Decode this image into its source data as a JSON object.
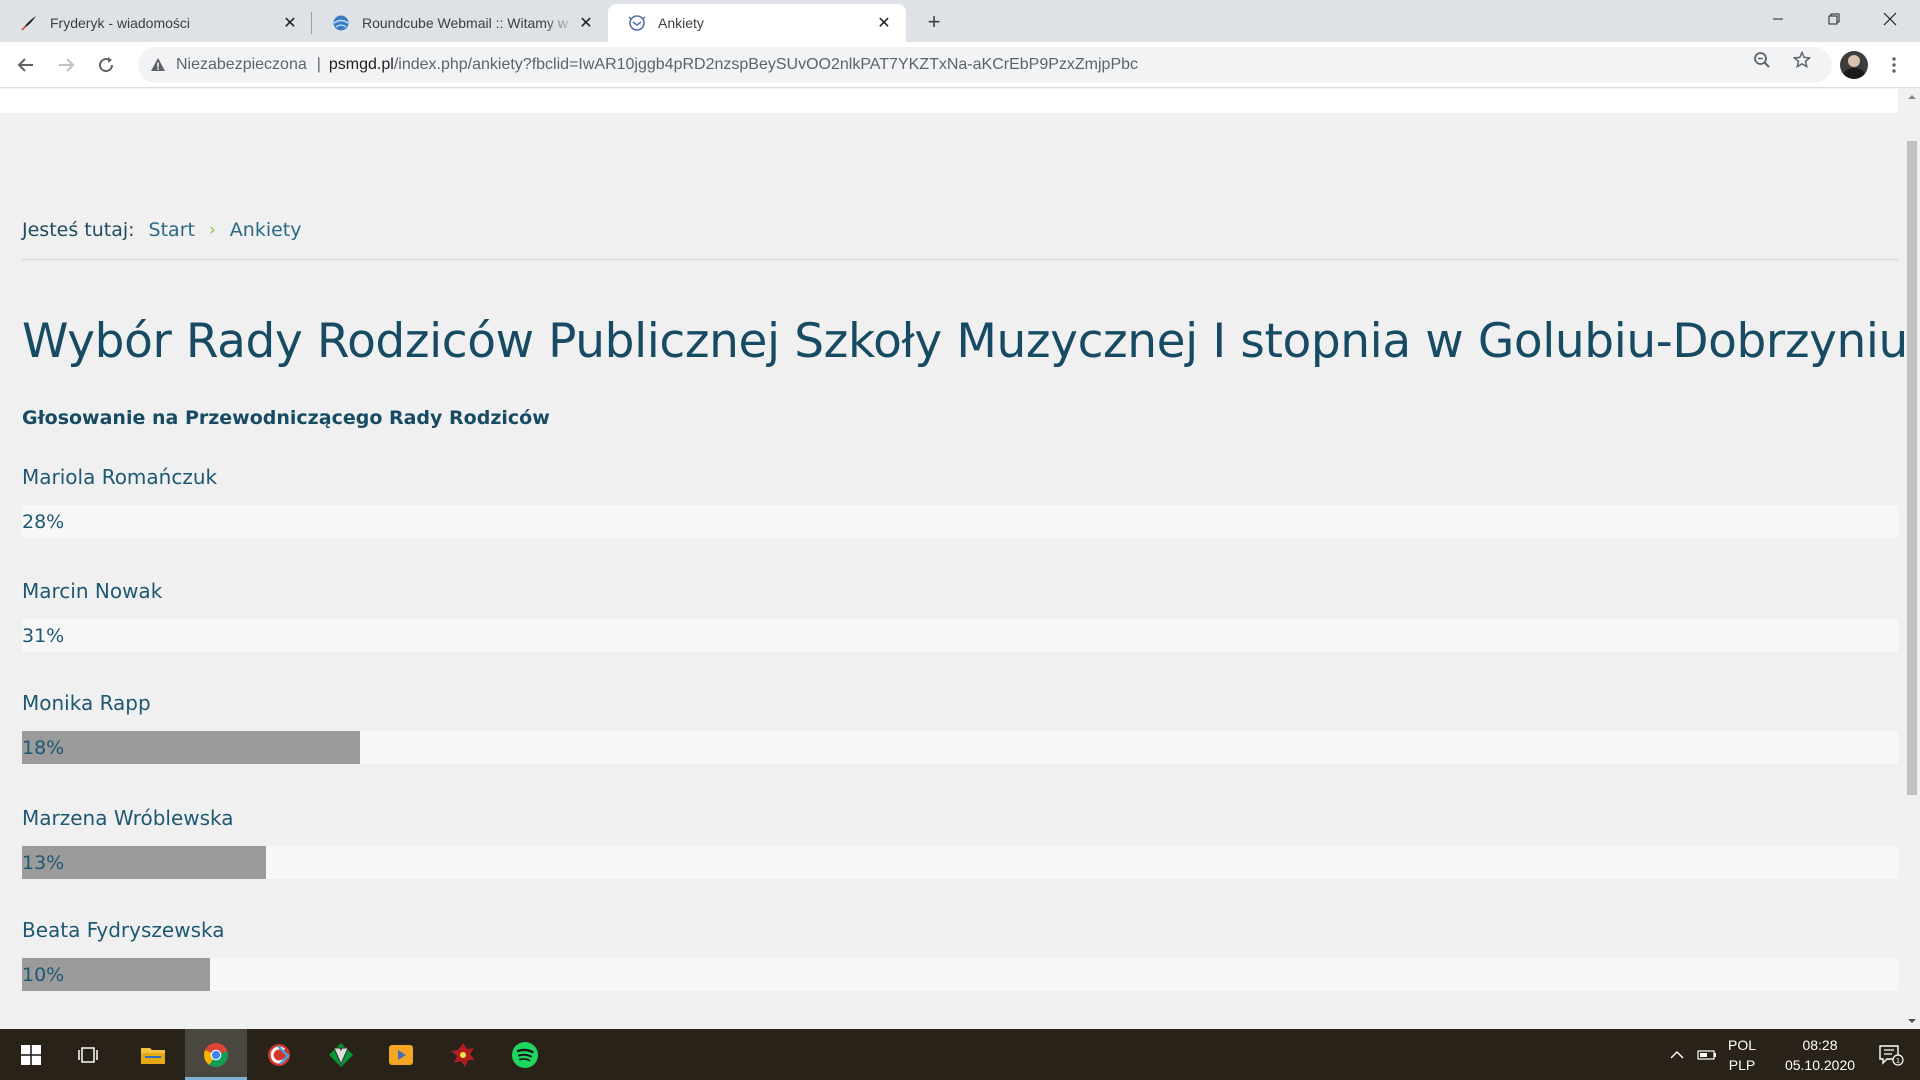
{
  "browser": {
    "tabs": [
      {
        "title": "Fryderyk - wiadomości",
        "favicon": "quill-pen-icon"
      },
      {
        "title": "Roundcube Webmail :: Witamy w",
        "favicon": "roundcube-globe-icon"
      },
      {
        "title": "Ankiety",
        "favicon": "ankiety-favicon-icon",
        "active": true
      }
    ],
    "address": {
      "security_label": "Niezabezpieczona",
      "separator": "|",
      "domain": "psmgd.pl",
      "path": "/index.php/ankiety?fbclid=IwAR10jggb4pRD2nzspBeySUvOO2nlkPAT7YKZTxNa-aKCrEbP9PzxZmjpPbc"
    }
  },
  "page": {
    "breadcrumb": {
      "lead": "Jesteś tutaj:",
      "items": [
        "Start",
        "Ankiety"
      ],
      "separator": "›"
    },
    "poll_title": "Wybór Rady Rodziców Publicznej Szkoły Muzycznej I stopnia w Golubiu-Dobrzyniu",
    "question": "Głosowanie na Przewodniczącego Rady Rodziców",
    "candidates": [
      {
        "name": "Mariola Romańczuk",
        "percent_label": "28%",
        "bar_fill_fraction": 0
      },
      {
        "name": "Marcin Nowak",
        "percent_label": "31%",
        "bar_fill_fraction": 0
      },
      {
        "name": "Monika Rapp",
        "percent_label": "18%",
        "bar_fill_fraction": 0.18
      },
      {
        "name": "Marzena Wróblewska",
        "percent_label": "13%",
        "bar_fill_fraction": 0.13
      },
      {
        "name": "Beata Fydryszewska",
        "percent_label": "10%",
        "bar_fill_fraction": 0.1
      }
    ]
  },
  "taskbar": {
    "apps": [
      "windows-start-icon",
      "task-view-icon",
      "file-explorer-icon",
      "chrome-icon",
      "ccleaner-icon",
      "vim-icon",
      "media-player-icon",
      "game-icon",
      "spotify-icon"
    ],
    "language_line1": "POL",
    "language_line2": "PLP",
    "time": "08:28",
    "date": "05.10.2020",
    "notification_count": "1"
  },
  "colors": {
    "heading": "#174b63",
    "link": "#2a6a85",
    "breadcrumb_separator": "#8cc63f",
    "bar_fill": "#9b9b9b",
    "bar_track": "#f7f7f7",
    "page_bg": "#f0f0f0"
  }
}
